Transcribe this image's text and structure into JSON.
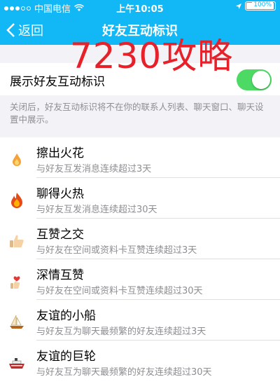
{
  "status_bar": {
    "carrier": "中国电信",
    "time": "上午10:05",
    "battery": "100%"
  },
  "nav": {
    "back_label": "返回",
    "title": "好友互动标识"
  },
  "watermark": "7230攻略",
  "toggle": {
    "label": "展示好友互动标识",
    "on": true
  },
  "note": "关闭后，好友互动标识将不在你的联系人列表、聊天窗口、聊天设置中展示。",
  "items": [
    {
      "title": "擦出火花",
      "desc": "与好友互发消息连续超过3天",
      "icon": "small-flame-icon"
    },
    {
      "title": "聊得火热",
      "desc": "与好友互发消息连续超过30天",
      "icon": "big-flame-icon"
    },
    {
      "title": "互赞之交",
      "desc": "与好友在空间或资料卡互赞连续超过3天",
      "icon": "thumbs-up-icon"
    },
    {
      "title": "深情互赞",
      "desc": "与好友在空间或资料卡互赞连续超过30天",
      "icon": "heart-thumbs-up-icon"
    },
    {
      "title": "友谊的小船",
      "desc": "与好友互为聊天最频繁的好友连续超过3天",
      "icon": "sailboat-icon"
    },
    {
      "title": "友谊的巨轮",
      "desc": "与好友互为聊天最频繁的好友连续超过30天",
      "icon": "ship-icon"
    }
  ]
}
